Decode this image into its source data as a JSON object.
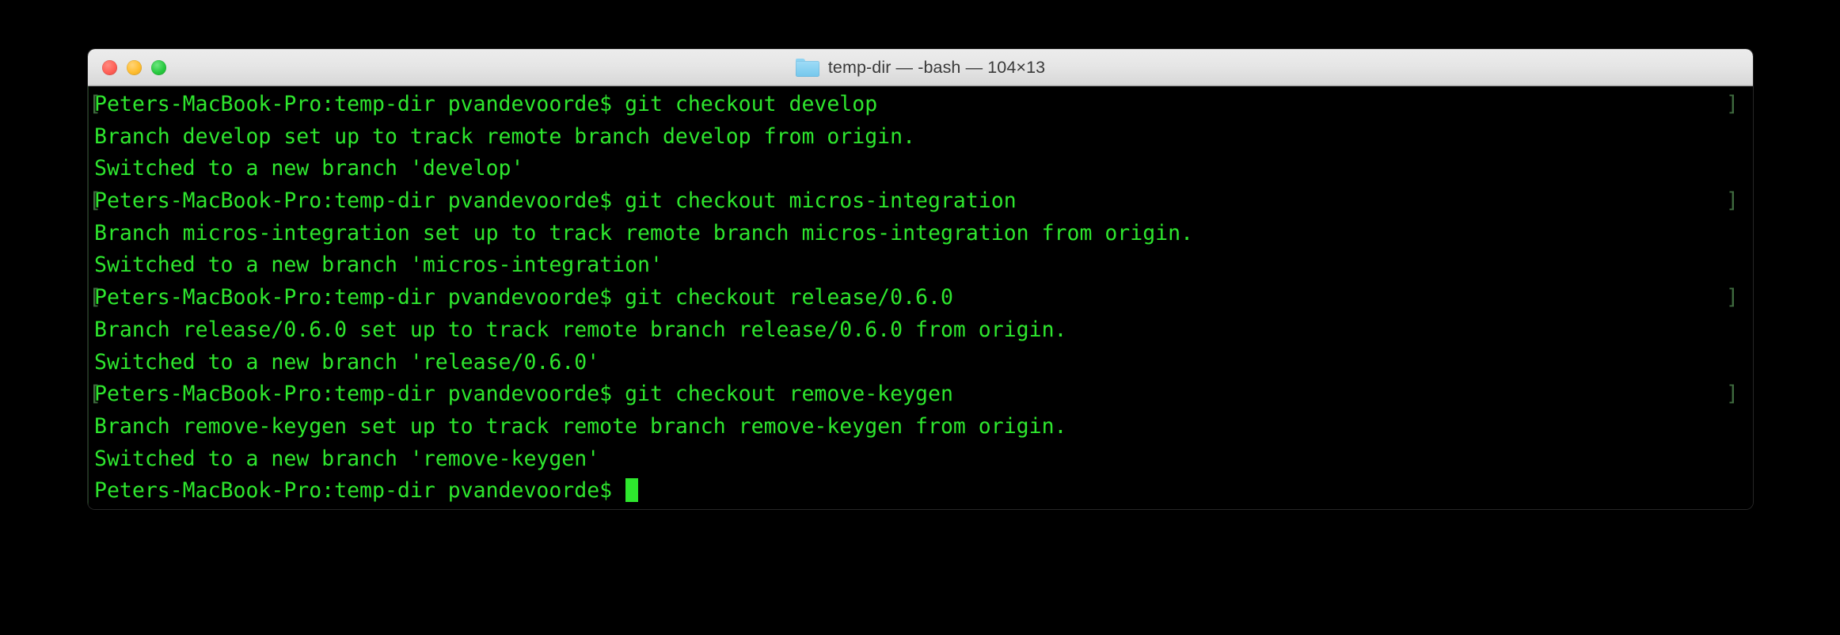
{
  "window": {
    "title": "temp-dir — -bash — 104×13",
    "folder_icon": "folder-icon",
    "traffic_lights": {
      "close": "close-button",
      "minimize": "minimize-button",
      "zoom": "zoom-button",
      "close_color": "#ff5f56",
      "minimize_color": "#ffbd2e",
      "zoom_color": "#27c93f"
    },
    "cols": 104,
    "rows": 13,
    "shell": "-bash",
    "directory": "temp-dir"
  },
  "theme": {
    "background": "#000000",
    "foreground": "#2ee62e",
    "mark_color": "#3f6b3f",
    "cursor_color": "#2ee62e"
  },
  "terminal": {
    "prompt": "Peters-MacBook-Pro:temp-dir pvandevoorde$ ",
    "mark_open": "[",
    "mark_close": "]",
    "lines": [
      {
        "text": "Peters-MacBook-Pro:temp-dir pvandevoorde$ git checkout develop",
        "prompt": true
      },
      {
        "text": "Branch develop set up to track remote branch develop from origin.",
        "prompt": false
      },
      {
        "text": "Switched to a new branch 'develop'",
        "prompt": false
      },
      {
        "text": "Peters-MacBook-Pro:temp-dir pvandevoorde$ git checkout micros-integration",
        "prompt": true
      },
      {
        "text": "Branch micros-integration set up to track remote branch micros-integration from origin.",
        "prompt": false
      },
      {
        "text": "Switched to a new branch 'micros-integration'",
        "prompt": false
      },
      {
        "text": "Peters-MacBook-Pro:temp-dir pvandevoorde$ git checkout release/0.6.0",
        "prompt": true
      },
      {
        "text": "Branch release/0.6.0 set up to track remote branch release/0.6.0 from origin.",
        "prompt": false
      },
      {
        "text": "Switched to a new branch 'release/0.6.0'",
        "prompt": false
      },
      {
        "text": "Peters-MacBook-Pro:temp-dir pvandevoorde$ git checkout remove-keygen",
        "prompt": true
      },
      {
        "text": "Branch remove-keygen set up to track remote branch remove-keygen from origin.",
        "prompt": false
      },
      {
        "text": "Switched to a new branch 'remove-keygen'",
        "prompt": false
      },
      {
        "text": "Peters-MacBook-Pro:temp-dir pvandevoorde$ ",
        "prompt": false,
        "cursor": true
      }
    ]
  }
}
